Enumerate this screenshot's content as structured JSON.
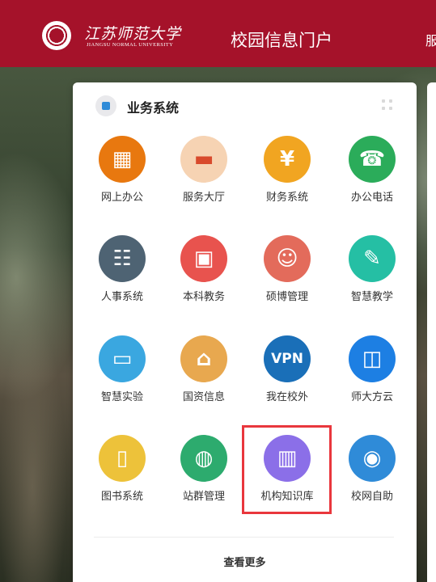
{
  "header": {
    "logo_cn": "江苏师范大学",
    "logo_en": "JIANGSU NORMAL UNIVERSITY",
    "portal_title": "校园信息门户",
    "nav_cut": "服"
  },
  "card": {
    "title": "业务系统",
    "more_label": "查看更多"
  },
  "apps": [
    {
      "label": "网上办公",
      "icon": "office-grid-icon",
      "color": "#e8780f"
    },
    {
      "label": "服务大厅",
      "icon": "sofa-icon",
      "color": "#f6d3b3"
    },
    {
      "label": "财务系统",
      "icon": "yen-icon",
      "color": "#f1a521"
    },
    {
      "label": "办公电话",
      "icon": "phone-icon",
      "color": "#2bac5a"
    },
    {
      "label": "人事系统",
      "icon": "org-chart-icon",
      "color": "#4e6373"
    },
    {
      "label": "本科教务",
      "icon": "teacher-board-icon",
      "color": "#e8534e"
    },
    {
      "label": "硕博管理",
      "icon": "graduate-icon",
      "color": "#e36b5b"
    },
    {
      "label": "智慧教学",
      "icon": "pen-icon",
      "color": "#25bfa4"
    },
    {
      "label": "智慧实验",
      "icon": "lab-screen-icon",
      "color": "#3aa7e0"
    },
    {
      "label": "国资信息",
      "icon": "bank-icon",
      "color": "#e8a84f"
    },
    {
      "label": "我在校外",
      "icon": "vpn-icon",
      "color": "#1a6fb8",
      "text": "VPN"
    },
    {
      "label": "师大方云",
      "icon": "cloud-squares-icon",
      "color": "#1d7fe3"
    },
    {
      "label": "图书系统",
      "icon": "book-icon",
      "color": "#edc23a"
    },
    {
      "label": "站群管理",
      "icon": "globe-hand-icon",
      "color": "#2dab6e"
    },
    {
      "label": "机构知识库",
      "icon": "open-book-icon",
      "color": "#8b6fe8"
    },
    {
      "label": "校网自助",
      "icon": "wifi-icon",
      "color": "#2f8bd8"
    }
  ]
}
